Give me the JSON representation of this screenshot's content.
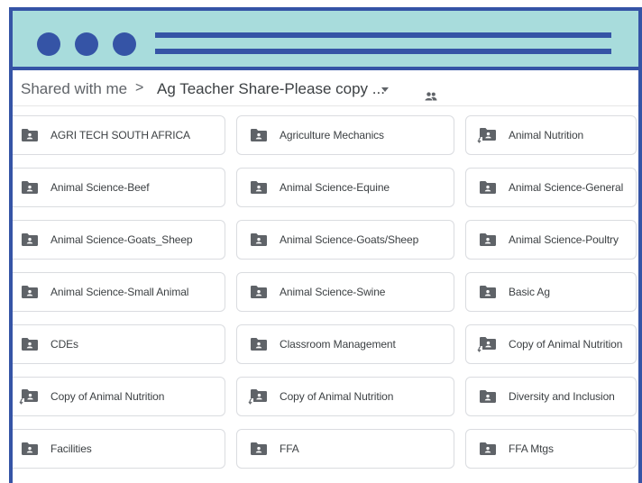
{
  "window": {
    "accent_color": "#3554a6",
    "titlebar_color": "#a8dcdc"
  },
  "breadcrumb": {
    "root": "Shared with me",
    "separator": ">",
    "current": "Ag Teacher Share-Please copy ...",
    "dropdown_icon": "caret-down-icon",
    "shared_icon": "people-icon"
  },
  "folders": [
    {
      "label": "AGRI TECH SOUTH AFRICA",
      "icon": "shared-folder-icon"
    },
    {
      "label": "Agriculture Mechanics",
      "icon": "shared-folder-icon"
    },
    {
      "label": "Animal Nutrition",
      "icon": "folder-shortcut-icon"
    },
    {
      "label": "Animal Science-Beef",
      "icon": "shared-folder-icon"
    },
    {
      "label": "Animal Science-Equine",
      "icon": "shared-folder-icon"
    },
    {
      "label": "Animal Science-General",
      "icon": "shared-folder-icon"
    },
    {
      "label": "Animal Science-Goats_Sheep",
      "icon": "shared-folder-icon"
    },
    {
      "label": "Animal Science-Goats/Sheep",
      "icon": "shared-folder-icon"
    },
    {
      "label": "Animal Science-Poultry",
      "icon": "shared-folder-icon"
    },
    {
      "label": "Animal Science-Small Animal",
      "icon": "shared-folder-icon"
    },
    {
      "label": "Animal Science-Swine",
      "icon": "shared-folder-icon"
    },
    {
      "label": "Basic Ag",
      "icon": "shared-folder-icon"
    },
    {
      "label": "CDEs",
      "icon": "shared-folder-icon"
    },
    {
      "label": "Classroom Management",
      "icon": "shared-folder-icon"
    },
    {
      "label": "Copy of Animal Nutrition",
      "icon": "folder-shortcut-icon"
    },
    {
      "label": "Copy of Animal Nutrition",
      "icon": "folder-shortcut-icon"
    },
    {
      "label": "Copy of Animal Nutrition",
      "icon": "folder-shortcut-icon"
    },
    {
      "label": "Diversity and Inclusion",
      "icon": "shared-folder-icon"
    },
    {
      "label": "Facilities",
      "icon": "shared-folder-icon"
    },
    {
      "label": "FFA",
      "icon": "shared-folder-icon"
    },
    {
      "label": "FFA Mtgs",
      "icon": "shared-folder-icon"
    }
  ]
}
